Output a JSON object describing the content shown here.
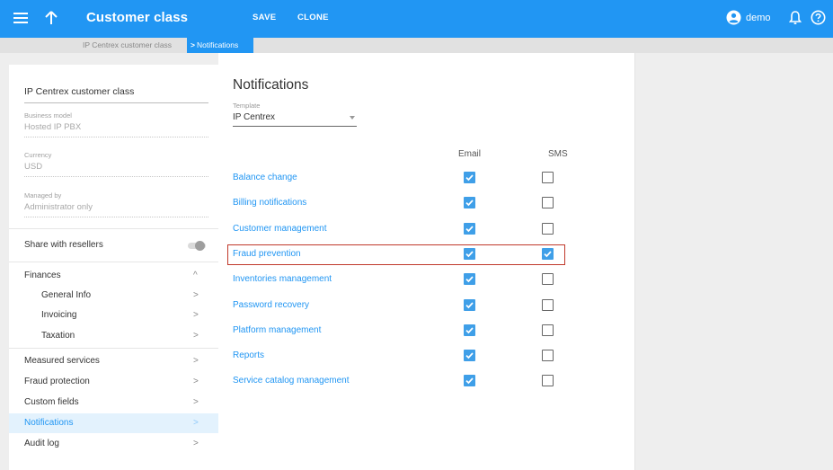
{
  "header": {
    "title": "Customer class",
    "save_label": "SAVE",
    "clone_label": "CLONE",
    "user_name": "demo",
    "bg_color": "#2196f3",
    "icons": [
      "menu-icon",
      "arrow-up-icon",
      "account-circle-icon",
      "bell-icon",
      "help-icon"
    ]
  },
  "breadcrumb": {
    "parent": "IP Centrex customer class",
    "separator": ">",
    "current": "Notifications"
  },
  "sidebar": {
    "class_name": "IP Centrex customer class",
    "fields": [
      {
        "label": "Business model",
        "value": "Hosted IP PBX"
      },
      {
        "label": "Currency",
        "value": "USD"
      },
      {
        "label": "Managed by",
        "value": "Administrator only"
      }
    ],
    "share_with_resellers": {
      "label": "Share with resellers",
      "enabled": false
    },
    "finances": {
      "label": "Finances",
      "chevron": "^"
    },
    "finances_items": [
      {
        "label": "General Info",
        "chevron": ">"
      },
      {
        "label": "Invoicing",
        "chevron": ">"
      },
      {
        "label": "Taxation",
        "chevron": ">"
      }
    ],
    "items": [
      {
        "label": "Measured services",
        "chevron": ">"
      },
      {
        "label": "Fraud protection",
        "chevron": ">"
      },
      {
        "label": "Custom fields",
        "chevron": ">"
      },
      {
        "label": "Notifications",
        "chevron": ">",
        "active": true
      },
      {
        "label": "Audit log",
        "chevron": ">"
      }
    ]
  },
  "main": {
    "title": "Notifications",
    "template": {
      "label": "Template",
      "value": "IP Centrex"
    },
    "columns": {
      "email": "Email",
      "sms": "SMS"
    },
    "rows": [
      {
        "label": "Balance change",
        "email": true,
        "sms": false
      },
      {
        "label": "Billing notifications",
        "email": true,
        "sms": false
      },
      {
        "label": "Customer management",
        "email": true,
        "sms": false
      },
      {
        "label": "Fraud prevention",
        "email": true,
        "sms": true,
        "highlighted": true
      },
      {
        "label": "Inventories management",
        "email": true,
        "sms": false
      },
      {
        "label": "Password recovery",
        "email": true,
        "sms": false
      },
      {
        "label": "Platform management",
        "email": true,
        "sms": false
      },
      {
        "label": "Reports",
        "email": true,
        "sms": false
      },
      {
        "label": "Service catalog management",
        "email": true,
        "sms": false
      }
    ],
    "checkbox_color": "#3f9fe8",
    "highlight_color": "#c0392b"
  }
}
